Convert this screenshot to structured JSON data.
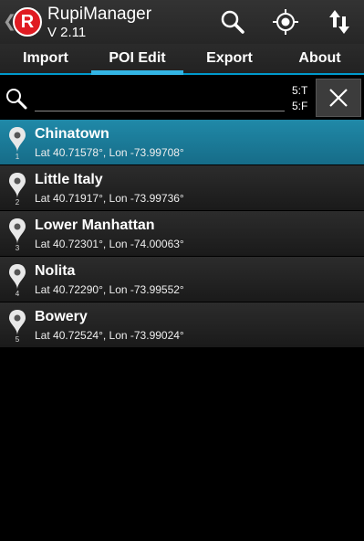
{
  "app": {
    "logo_letter": "R",
    "title": "RupiManager",
    "version": "V 2.11",
    "back_glyph": "❮",
    "actions": [
      "search-icon",
      "locate-icon",
      "sort-icon"
    ]
  },
  "tabs": [
    {
      "label": "Import",
      "active": false
    },
    {
      "label": "POI Edit",
      "active": true
    },
    {
      "label": "Export",
      "active": false
    },
    {
      "label": "About",
      "active": false
    }
  ],
  "search": {
    "value": "",
    "placeholder": "",
    "count_top": "5:T",
    "count_bottom": "5:F"
  },
  "pois": [
    {
      "num": "1",
      "name": "Chinatown",
      "coords": "Lat 40.71578°, Lon -73.99708°",
      "selected": true
    },
    {
      "num": "2",
      "name": "Little Italy",
      "coords": "Lat 40.71917°, Lon -73.99736°",
      "selected": false
    },
    {
      "num": "3",
      "name": "Lower Manhattan",
      "coords": "Lat 40.72301°, Lon -74.00063°",
      "selected": false
    },
    {
      "num": "4",
      "name": "Nolita",
      "coords": "Lat 40.72290°, Lon -73.99552°",
      "selected": false
    },
    {
      "num": "5",
      "name": "Bowery",
      "coords": "Lat 40.72524°, Lon -73.99024°",
      "selected": false
    }
  ],
  "colors": {
    "accent": "#33b5e5",
    "selected_row": "#1a7b9a",
    "logo_red": "#e01b22"
  }
}
